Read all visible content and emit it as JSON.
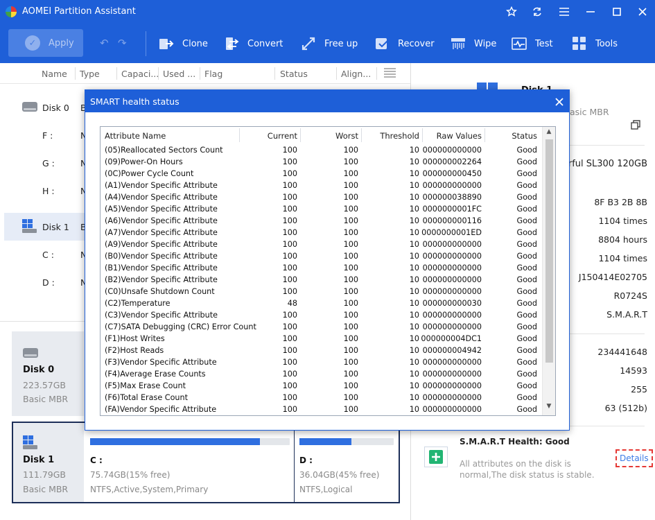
{
  "window": {
    "title": "AOMEI Partition Assistant"
  },
  "window_controls": [
    "star-icon",
    "refresh-icon",
    "menu-icon",
    "minimize-icon",
    "maximize-icon",
    "close-icon"
  ],
  "toolbar": {
    "apply": "Apply",
    "tools": [
      {
        "label": "Clone",
        "icon": "clone-icon"
      },
      {
        "label": "Convert",
        "icon": "convert-icon"
      },
      {
        "label": "Free up",
        "icon": "free-up-icon"
      },
      {
        "label": "Recover",
        "icon": "recover-icon"
      },
      {
        "label": "Wipe",
        "icon": "wipe-icon"
      },
      {
        "label": "Test",
        "icon": "test-icon"
      },
      {
        "label": "Tools",
        "icon": "tools-icon"
      }
    ]
  },
  "columns": [
    "Name",
    "Type",
    "Capaci...",
    "Used ...",
    "Flag",
    "Status",
    "Align..."
  ],
  "tree": {
    "disk0": {
      "label": "Disk 0",
      "type": "B"
    },
    "disk0_parts": [
      {
        "label": "F :",
        "type": "N"
      },
      {
        "label": "G :",
        "type": "N"
      },
      {
        "label": "H :",
        "type": "N"
      }
    ],
    "disk1": {
      "label": "Disk 1",
      "type": "B"
    },
    "disk1_parts": [
      {
        "label": "C :",
        "type": "N"
      },
      {
        "label": "D :",
        "type": "N"
      }
    ]
  },
  "cards": {
    "disk0": {
      "name": "Disk 0",
      "size": "223.57GB",
      "style": "Basic MBR"
    },
    "disk1": {
      "name": "Disk 1",
      "size": "111.79GB",
      "style": "Basic MBR"
    },
    "part_c": {
      "label": "C :",
      "free": "75.74GB(15% free)",
      "fs": "NTFS,Active,System,Primary",
      "used_fraction": 0.85
    },
    "part_d": {
      "label": "D :",
      "free": "36.04GB(45% free)",
      "fs": "NTFS,Logical",
      "used_fraction": 0.55
    }
  },
  "right": {
    "disk_name": "Disk 1",
    "disk_type": "asic MBR",
    "model": "lorful SL300 120GB",
    "values": [
      "8F B3 2B 8B",
      "1104 times",
      "8804 hours",
      "1104 times",
      "J150414E02705",
      "R0724S",
      "S.M.A.R.T"
    ],
    "values2": [
      "234441648",
      "14593",
      "255",
      "63 (512b)"
    ],
    "health_title": "S.M.A.R.T Health: Good",
    "health_desc_1": "All attributes on the disk is",
    "health_desc_2": "normal,The disk status is stable.",
    "details": "Details"
  },
  "dialog": {
    "title": "SMART health status",
    "headers": {
      "name": "Attribute Name",
      "current": "Current",
      "worst": "Worst",
      "threshold": "Threshold",
      "raw": "Raw Values",
      "status": "Status"
    },
    "rows": [
      {
        "name": "(05)Reallocated Sectors Count",
        "current": "100",
        "worst": "100",
        "threshold": "10",
        "raw": "000000000000",
        "status": "Good"
      },
      {
        "name": "(09)Power-On Hours",
        "current": "100",
        "worst": "100",
        "threshold": "10",
        "raw": "000000002264",
        "status": "Good"
      },
      {
        "name": "(0C)Power Cycle Count",
        "current": "100",
        "worst": "100",
        "threshold": "10",
        "raw": "000000000450",
        "status": "Good"
      },
      {
        "name": "(A1)Vendor Specific Attribute",
        "current": "100",
        "worst": "100",
        "threshold": "10",
        "raw": "000000000000",
        "status": "Good"
      },
      {
        "name": "(A4)Vendor Specific Attribute",
        "current": "100",
        "worst": "100",
        "threshold": "10",
        "raw": "000000038890",
        "status": "Good"
      },
      {
        "name": "(A5)Vendor Specific Attribute",
        "current": "100",
        "worst": "100",
        "threshold": "10",
        "raw": "0000000001FC",
        "status": "Good"
      },
      {
        "name": "(A6)Vendor Specific Attribute",
        "current": "100",
        "worst": "100",
        "threshold": "10",
        "raw": "000000000116",
        "status": "Good"
      },
      {
        "name": "(A7)Vendor Specific Attribute",
        "current": "100",
        "worst": "100",
        "threshold": "10",
        "raw": "0000000001ED",
        "status": "Good"
      },
      {
        "name": "(A9)Vendor Specific Attribute",
        "current": "100",
        "worst": "100",
        "threshold": "10",
        "raw": "000000000000",
        "status": "Good"
      },
      {
        "name": "(B0)Vendor Specific Attribute",
        "current": "100",
        "worst": "100",
        "threshold": "10",
        "raw": "000000000000",
        "status": "Good"
      },
      {
        "name": "(B1)Vendor Specific Attribute",
        "current": "100",
        "worst": "100",
        "threshold": "10",
        "raw": "000000000000",
        "status": "Good"
      },
      {
        "name": "(B2)Vendor Specific Attribute",
        "current": "100",
        "worst": "100",
        "threshold": "10",
        "raw": "000000000000",
        "status": "Good"
      },
      {
        "name": "(C0)Unsafe Shutdown Count",
        "current": "100",
        "worst": "100",
        "threshold": "10",
        "raw": "000000000000",
        "status": "Good"
      },
      {
        "name": "(C2)Temperature",
        "current": "48",
        "worst": "100",
        "threshold": "10",
        "raw": "000000000030",
        "status": "Good"
      },
      {
        "name": "(C3)Vendor Specific Attribute",
        "current": "100",
        "worst": "100",
        "threshold": "10",
        "raw": "000000000000",
        "status": "Good"
      },
      {
        "name": "(C7)SATA Debugging (CRC) Error Count",
        "current": "100",
        "worst": "100",
        "threshold": "10",
        "raw": "000000000000",
        "status": "Good"
      },
      {
        "name": "(F1)Host Writes",
        "current": "100",
        "worst": "100",
        "threshold": "10",
        "raw": "000000004DC1",
        "status": "Good"
      },
      {
        "name": "(F2)Host Reads",
        "current": "100",
        "worst": "100",
        "threshold": "10",
        "raw": "000000004942",
        "status": "Good"
      },
      {
        "name": "(F3)Vendor Specific Attribute",
        "current": "100",
        "worst": "100",
        "threshold": "10",
        "raw": "000000000000",
        "status": "Good"
      },
      {
        "name": "(F4)Average Erase Counts",
        "current": "100",
        "worst": "100",
        "threshold": "10",
        "raw": "000000000000",
        "status": "Good"
      },
      {
        "name": "(F5)Max Erase Count",
        "current": "100",
        "worst": "100",
        "threshold": "10",
        "raw": "000000000000",
        "status": "Good"
      },
      {
        "name": "(F6)Total Erase Count",
        "current": "100",
        "worst": "100",
        "threshold": "10",
        "raw": "000000000000",
        "status": "Good"
      },
      {
        "name": "(FA)Vendor Specific Attribute",
        "current": "100",
        "worst": "100",
        "threshold": "10",
        "raw": "000000000000",
        "status": "Good"
      }
    ]
  }
}
